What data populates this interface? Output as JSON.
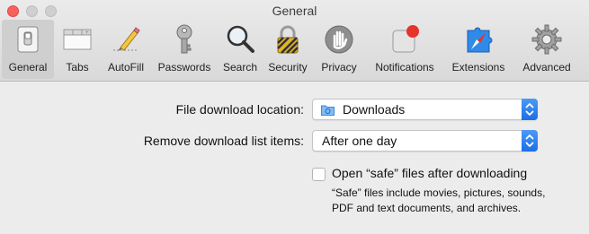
{
  "window": {
    "title": "General"
  },
  "toolbar": {
    "tabs": [
      {
        "label": "General",
        "icon": "general-switch-icon",
        "active": true
      },
      {
        "label": "Tabs",
        "icon": "tabs-icon",
        "active": false
      },
      {
        "label": "AutoFill",
        "icon": "autofill-pencil-icon",
        "active": false
      },
      {
        "label": "Passwords",
        "icon": "key-icon",
        "active": false
      },
      {
        "label": "Search",
        "icon": "magnifier-icon",
        "active": false
      },
      {
        "label": "Security",
        "icon": "padlock-icon",
        "active": false
      },
      {
        "label": "Privacy",
        "icon": "hand-icon",
        "active": false
      },
      {
        "label": "Notifications",
        "icon": "notifications-badge-icon",
        "active": false
      },
      {
        "label": "Extensions",
        "icon": "puzzle-compass-icon",
        "active": false
      },
      {
        "label": "Advanced",
        "icon": "gear-icon",
        "active": false
      }
    ]
  },
  "settings": {
    "download_location": {
      "label": "File download location:",
      "value": "Downloads",
      "icon": "folder-icon"
    },
    "remove_items": {
      "label": "Remove download list items:",
      "value": "After one day"
    },
    "open_safe": {
      "label": "Open “safe” files after downloading",
      "checked": false,
      "help": "“Safe” files include movies, pictures, sounds, PDF and text documents, and archives."
    }
  },
  "colors": {
    "accent": "#1b6fe6",
    "close": "#fc605b",
    "notification_dot": "#e8322c",
    "window_bg": "#ececec"
  }
}
